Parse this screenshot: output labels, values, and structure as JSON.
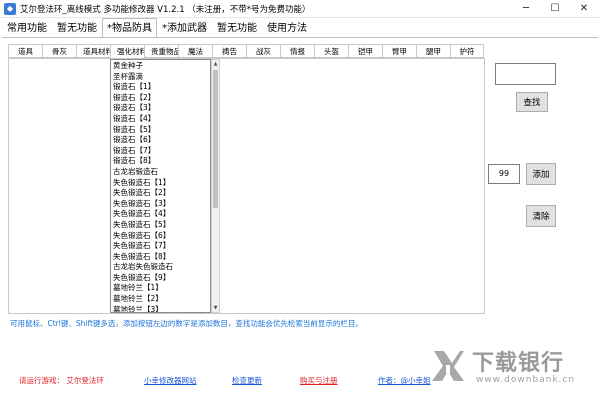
{
  "window": {
    "title": "艾尔登法环_离线模式 多功能修改器  V1.2.1 （未注册，不带*号为免费功能）",
    "minimize": "─",
    "maximize": "☐",
    "close": "✕"
  },
  "top_tabs": [
    "常用功能",
    "暂无功能",
    "*物品防具",
    "*添加武器",
    "暂无功能",
    "使用方法"
  ],
  "top_tabs_active_index": 2,
  "sub_tabs": [
    "道具",
    "骨灰",
    "道具材料",
    "强化材料",
    "贵重物品",
    "魔法",
    "祷告",
    "战灰",
    "情报",
    "头盔",
    "铠甲",
    "臂甲",
    "腿甲",
    "护符"
  ],
  "sub_tabs_active_index": 3,
  "items": [
    "黄金种子",
    "圣杯露滴",
    "锻造石【1】",
    "锻造石【2】",
    "锻造石【3】",
    "锻造石【4】",
    "锻造石【5】",
    "锻造石【6】",
    "锻造石【7】",
    "锻造石【8】",
    "古龙岩锻造石",
    "失色锻造石【1】",
    "失色锻造石【2】",
    "失色锻造石【3】",
    "失色锻造石【4】",
    "失色锻造石【5】",
    "失色锻造石【6】",
    "失色锻造石【7】",
    "失色锻造石【8】",
    "古龙岩失色锻造石",
    "失色锻造石【9】",
    "墓地铃兰【1】",
    "墓地铃兰【2】",
    "墓地铃兰【3】"
  ],
  "search": {
    "value": "",
    "button": "查找"
  },
  "add": {
    "quantity": "99",
    "button": "添加"
  },
  "clear": {
    "button": "清除"
  },
  "hint": "可用鼠标、Ctrl键、Shift键多选，添加按钮左边的数字是添加数目，查找功能会优先检索当前显示的栏目。",
  "footer": {
    "game": "请运行游戏：  艾尔登法环",
    "site": "小幸修改器网站",
    "update": "检查更新",
    "register": "购买与注册",
    "author": "作者：@小幸姐"
  },
  "watermark": {
    "name": "下载银行",
    "url": "www.downbank.cn"
  }
}
